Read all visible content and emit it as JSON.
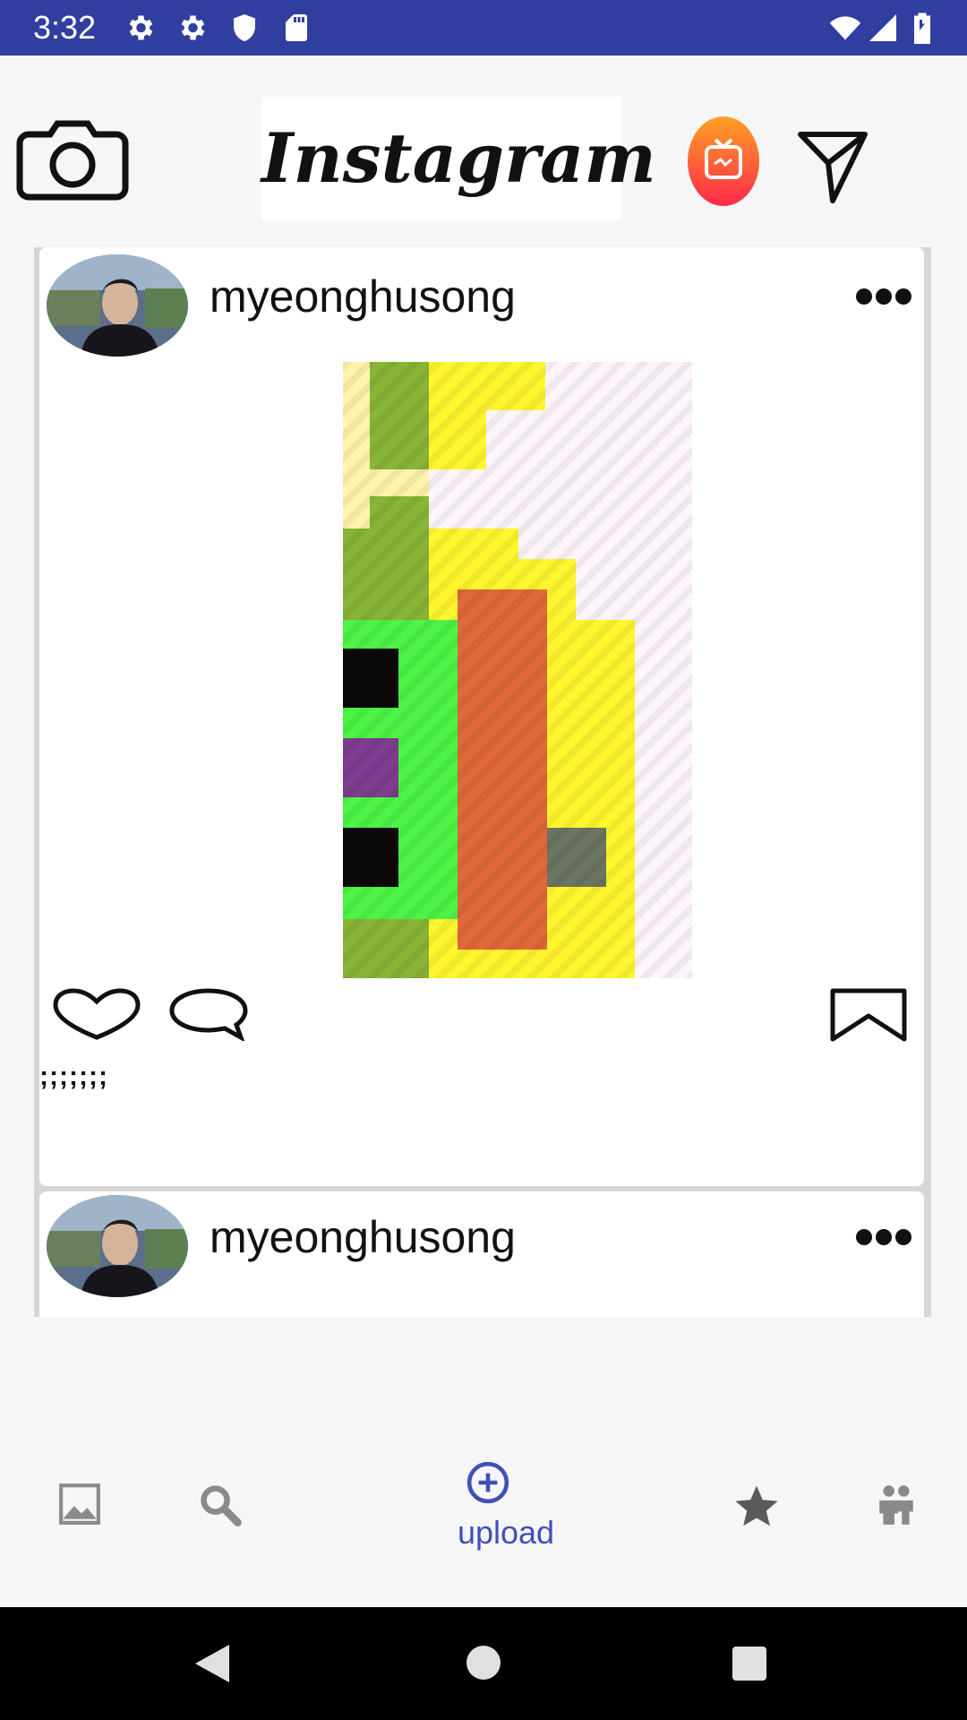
{
  "status_bar": {
    "time": "3:32",
    "icons_left": [
      "settings-icon",
      "settings-icon",
      "shield-icon",
      "sd-card-icon"
    ],
    "icons_right": [
      "wifi-icon",
      "signal-icon",
      "battery-icon"
    ],
    "background": "#303f9f"
  },
  "app_bar": {
    "logo_text": "Instagram",
    "left_icon": "camera-icon",
    "right_icons": [
      "igtv-icon",
      "direct-message-icon"
    ]
  },
  "feed": {
    "posts": [
      {
        "username": "myeonghusong",
        "caption": ";;;;;;;",
        "actions": [
          "like-icon",
          "comment-icon",
          "bookmark-icon"
        ]
      },
      {
        "username": "myeonghusong"
      }
    ]
  },
  "bottom_nav": {
    "items": [
      {
        "icon": "gallery-icon",
        "label": ""
      },
      {
        "icon": "search-icon",
        "label": ""
      },
      {
        "icon": "add-circle-icon",
        "label": "upload",
        "selected": true
      },
      {
        "icon": "star-icon",
        "label": ""
      },
      {
        "icon": "people-icon",
        "label": ""
      }
    ],
    "accent": "#3f51b5"
  },
  "system_nav": {
    "icons": [
      "back-icon",
      "home-icon",
      "recents-icon"
    ]
  }
}
